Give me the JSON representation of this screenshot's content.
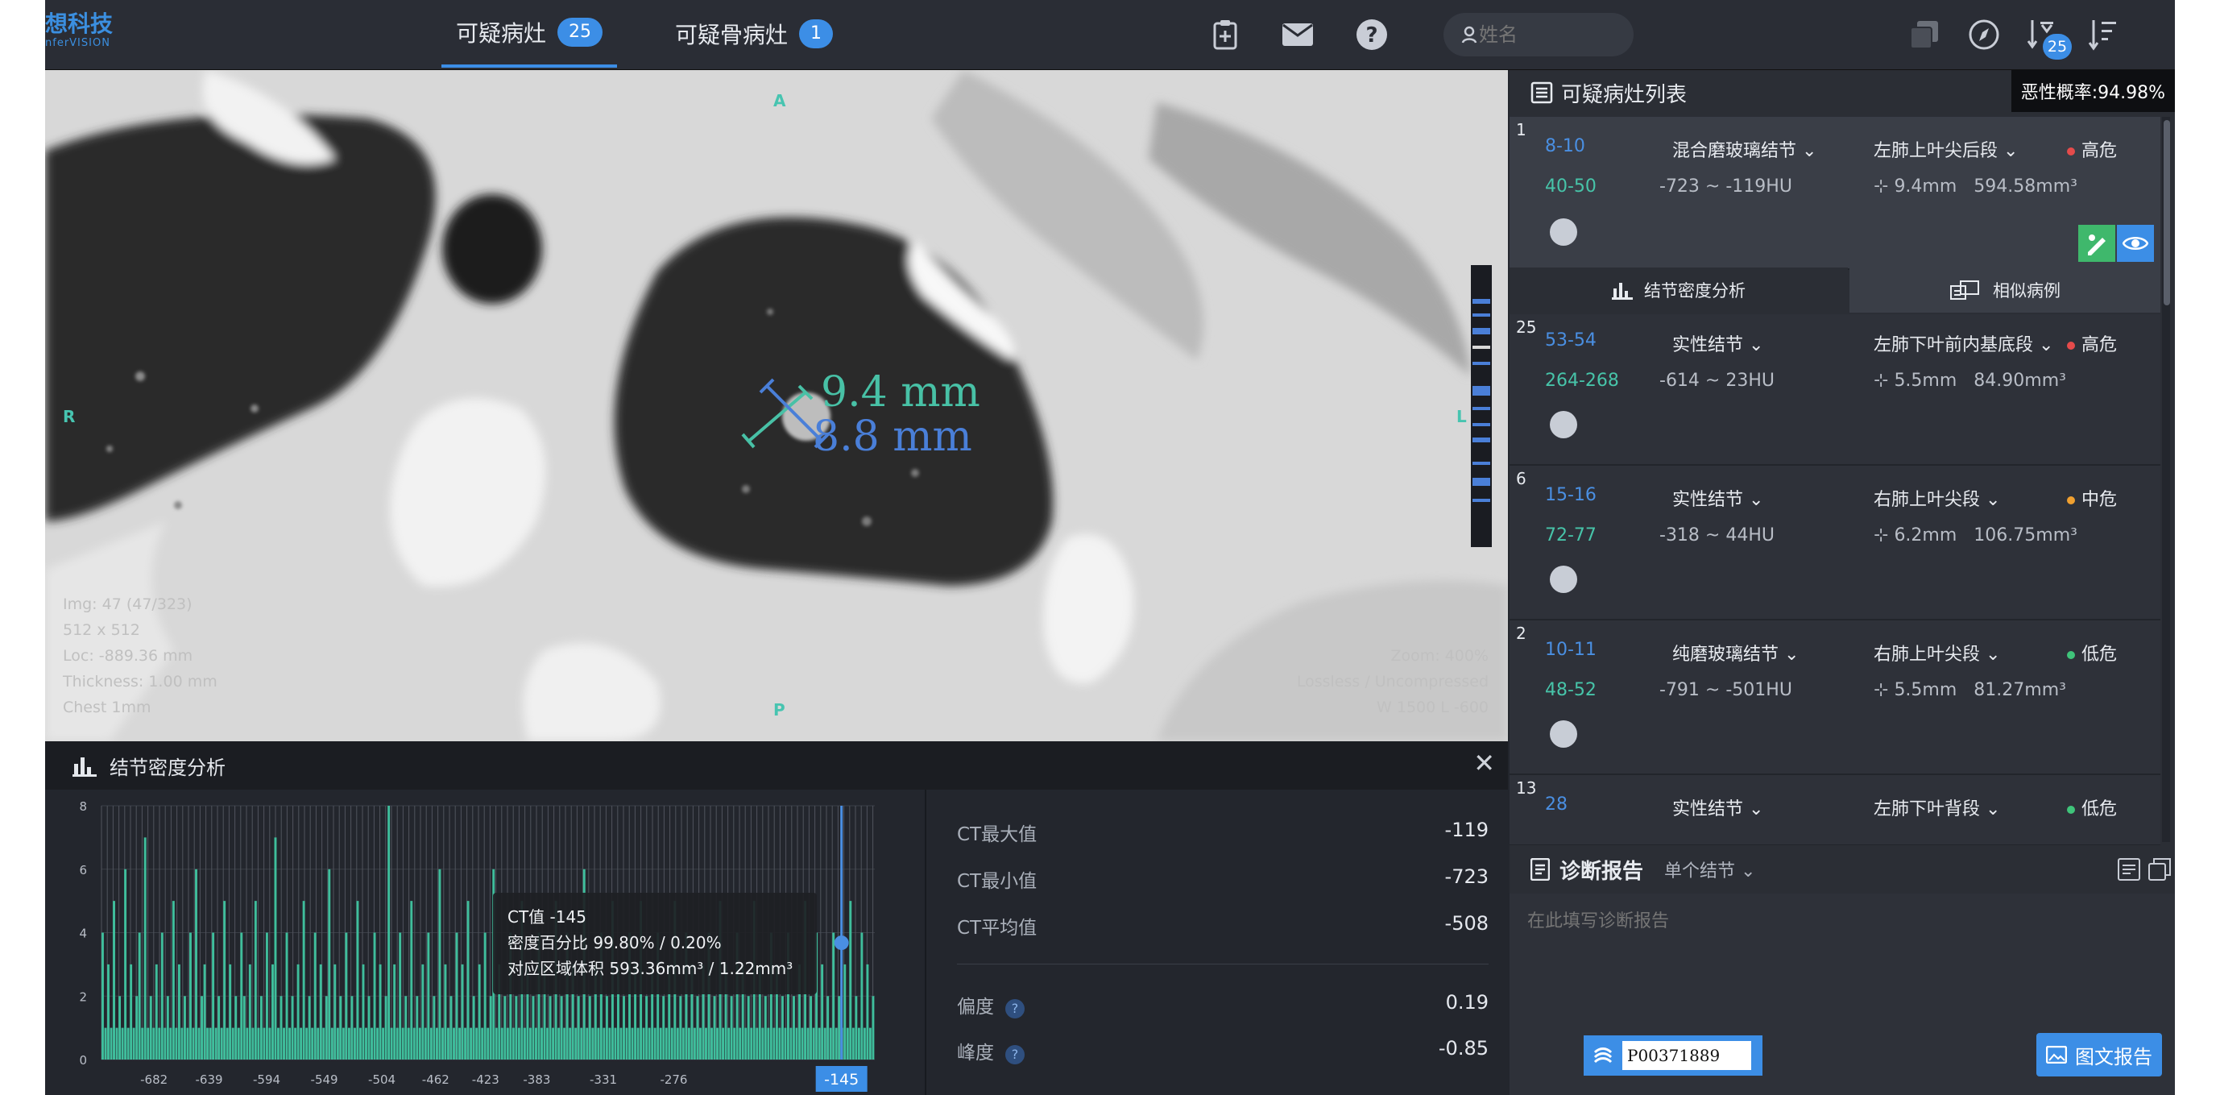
{
  "app": {
    "logo_cn": "想科技",
    "logo_en": "nferVISION"
  },
  "topbar": {
    "tabs": [
      {
        "label": "可疑病灶",
        "count": "25"
      },
      {
        "label": "可疑骨病灶",
        "count": "1"
      }
    ],
    "icons": [
      "clipboard-add-icon",
      "mail-icon",
      "help-icon"
    ],
    "search_placeholder": "姓名",
    "right_icons": [
      "layers-icon",
      "compass-icon",
      "sort-desc-icon",
      "filter-sort-icon"
    ],
    "sort_badge": "25"
  },
  "viewer": {
    "info_left": [
      "Img: 47 (47/323)",
      "512 x 512",
      "Loc: -889.36 mm",
      "Thickness: 1.00 mm",
      "Chest 1mm"
    ],
    "info_right": [
      "Zoom: 400%",
      "Lossless / Uncompressed",
      "W 1500 L -600"
    ],
    "orient_top": "A",
    "orient_left": "R",
    "orient_right": "L",
    "orient_bottom": "P",
    "measure_long": "9.4 mm",
    "measure_short": "8.8 mm"
  },
  "density_panel": {
    "title": "结节密度分析",
    "tooltip_ct": "CT值  -145",
    "tooltip_pct": "密度百分比  99.80% / 0.20%",
    "tooltip_vol": "对应区域体积  593.36mm³ / 1.22mm³",
    "stats": [
      {
        "label": "CT最大值",
        "value": "-119"
      },
      {
        "label": "CT最小值",
        "value": "-723"
      },
      {
        "label": "CT平均值",
        "value": "-508"
      },
      {
        "label": "偏度",
        "value": "0.19"
      },
      {
        "label": "峰度",
        "value": "-0.85"
      }
    ]
  },
  "chart_data": {
    "type": "bar",
    "xlabel": "",
    "ylabel": "",
    "ylim": [
      0,
      8
    ],
    "yticks": [
      "0",
      "2",
      "4",
      "6",
      "8"
    ],
    "xticks": [
      "-682",
      "-639",
      "-594",
      "-549",
      "-504",
      "-462",
      "-423",
      "-383",
      "-331",
      "-276"
    ],
    "xrange": [
      -723,
      -119
    ],
    "cursor_value": "-145",
    "values": [
      4,
      1,
      3,
      1,
      5,
      1,
      2,
      1,
      6,
      1,
      3,
      1,
      2,
      4,
      1,
      7,
      1,
      2,
      1,
      3,
      1,
      4,
      1,
      2,
      1,
      5,
      1,
      3,
      1,
      2,
      1,
      4,
      1,
      6,
      1,
      2,
      3,
      1,
      1,
      4,
      1,
      2,
      1,
      5,
      1,
      3,
      1,
      2,
      1,
      4,
      2,
      1,
      3,
      1,
      5,
      1,
      2,
      1,
      4,
      1,
      3,
      7,
      1,
      2,
      1,
      4,
      1,
      2,
      1,
      3,
      1,
      5,
      1,
      2,
      1,
      4,
      1,
      3,
      1,
      2,
      6,
      1,
      3,
      1,
      2,
      1,
      4,
      1,
      2,
      1,
      5,
      1,
      3,
      1,
      2,
      1,
      4,
      1,
      3,
      1,
      2,
      8,
      1,
      3,
      1,
      4,
      1,
      2,
      1,
      5,
      1,
      2,
      1,
      3,
      1,
      4,
      1,
      2,
      1,
      6,
      1,
      3,
      1,
      2,
      1,
      4,
      1,
      3,
      1,
      5,
      1,
      2,
      1,
      3,
      1,
      4,
      1,
      2,
      6,
      1,
      3,
      1,
      2,
      1,
      4,
      1,
      2,
      1,
      5,
      1,
      3,
      1,
      2,
      1,
      4,
      1,
      3,
      1,
      2,
      1,
      5,
      1,
      2,
      1,
      4,
      1,
      3,
      1,
      2,
      1,
      6,
      1,
      2,
      1,
      3,
      1,
      4,
      1,
      2,
      1,
      5,
      1,
      3,
      1,
      2,
      1,
      4,
      1,
      3,
      1,
      5,
      1,
      2,
      1,
      3,
      1,
      4,
      1,
      2,
      1,
      3,
      1,
      5,
      1,
      2,
      1,
      4,
      1,
      3,
      1,
      2,
      1,
      3,
      1,
      4,
      1,
      2,
      1,
      5,
      1,
      3,
      1,
      2,
      1,
      4,
      1,
      3,
      1,
      2,
      1,
      5,
      1,
      3,
      1,
      2,
      1,
      4,
      1,
      3,
      1,
      2,
      1,
      4,
      1,
      2,
      1,
      3,
      1,
      5,
      1,
      2,
      1,
      4,
      1,
      3,
      1,
      2,
      1,
      4,
      1,
      2,
      1,
      3,
      1,
      5,
      1,
      2,
      1,
      4,
      1,
      3,
      1,
      2
    ]
  },
  "lesion_list": {
    "title": "可疑病灶列表",
    "tooltip": "恶性概率:94.98%",
    "subtabs": [
      "结节密度分析",
      "相似病例"
    ],
    "items": [
      {
        "num": "1",
        "slices": "8-10",
        "type": "混合磨玻璃结节",
        "location": "左肺上叶尖后段",
        "risk": "高危",
        "risk_color": "#e54b4b",
        "range": "40-50",
        "hu": "-723 ~ -119HU",
        "size": "9.4mm",
        "volume": "594.58mm³"
      },
      {
        "num": "25",
        "slices": "53-54",
        "type": "实性结节",
        "location": "左肺下叶前内基底段",
        "risk": "高危",
        "risk_color": "#e54b4b",
        "range": "264-268",
        "hu": "-614 ~ 23HU",
        "size": "5.5mm",
        "volume": "84.90mm³"
      },
      {
        "num": "6",
        "slices": "15-16",
        "type": "实性结节",
        "location": "右肺上叶尖段",
        "risk": "中危",
        "risk_color": "#f0a030",
        "range": "72-77",
        "hu": "-318 ~ 44HU",
        "size": "6.2mm",
        "volume": "106.75mm³"
      },
      {
        "num": "2",
        "slices": "10-11",
        "type": "纯磨玻璃结节",
        "location": "右肺上叶尖段",
        "risk": "低危",
        "risk_color": "#3fc47a",
        "range": "48-52",
        "hu": "-791 ~ -501HU",
        "size": "5.5mm",
        "volume": "81.27mm³"
      },
      {
        "num": "13",
        "slices": "28",
        "type": "实性结节",
        "location": "左肺下叶背段",
        "risk": "低危",
        "risk_color": "#3fc47a"
      }
    ]
  },
  "report": {
    "title": "诊断报告",
    "mode": "单个结节",
    "placeholder": "在此填写诊断报告",
    "patient_id": "P00371889",
    "button": "图文报告"
  }
}
